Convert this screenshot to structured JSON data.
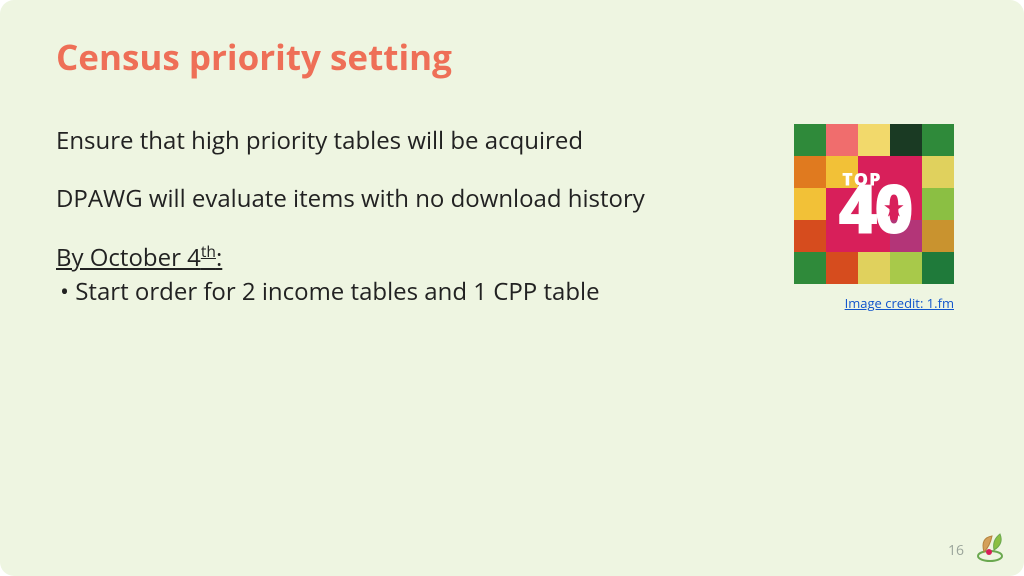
{
  "title": "Census priority setting",
  "para1": "Ensure that high priority tables will be acquired",
  "para2": "DPAWG will evaluate items with no download history",
  "deadline_prefix": "By October 4",
  "deadline_suffix": "th",
  "deadline_colon": ":",
  "bullet1": "• Start order for 2 income tables and 1 CPP table",
  "top40": {
    "top": "TOP",
    "four": "4",
    "zero": "0",
    "star": "★"
  },
  "credit": "Image credit: 1.fm",
  "page_number": "16",
  "grid_colors": [
    "#2f8a3a",
    "#f06d6d",
    "#f2d96b",
    "#1a3a23",
    "#2f8a3a",
    "#e07a1f",
    "#f2c137",
    "#d81f5a",
    "#d81f5a",
    "#e0d15d",
    "#f2c137",
    "#d81f5a",
    "#d81f5a",
    "#d81f5a",
    "#8bbf43",
    "#d64c1e",
    "#d81f5a",
    "#d81f5a",
    "#b33578",
    "#c9932f",
    "#2f8a3a",
    "#d64c1e",
    "#e0d15d",
    "#a8c94a",
    "#1f7a3a"
  ]
}
